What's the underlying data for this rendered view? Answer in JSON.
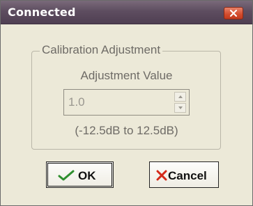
{
  "window": {
    "title": "Connected"
  },
  "calibration": {
    "group_label": "Calibration Adjustment",
    "adjustment_label": "Adjustment Value",
    "value": "1.0",
    "range_text": "(-12.5dB to 12.5dB)"
  },
  "buttons": {
    "ok_label": "OK",
    "cancel_label": "Cancel"
  },
  "icons": {
    "close": "close-icon",
    "spin_up": "chevron-up-icon",
    "spin_down": "chevron-down-icon",
    "ok": "checkmark-icon",
    "cancel": "cross-icon"
  },
  "colors": {
    "titlebar": "#5e4d60",
    "close_button": "#d34b2c",
    "ok_check": "#2f8f2f",
    "cancel_cross": "#d42a1a",
    "dialog_bg": "#ece9d8"
  }
}
